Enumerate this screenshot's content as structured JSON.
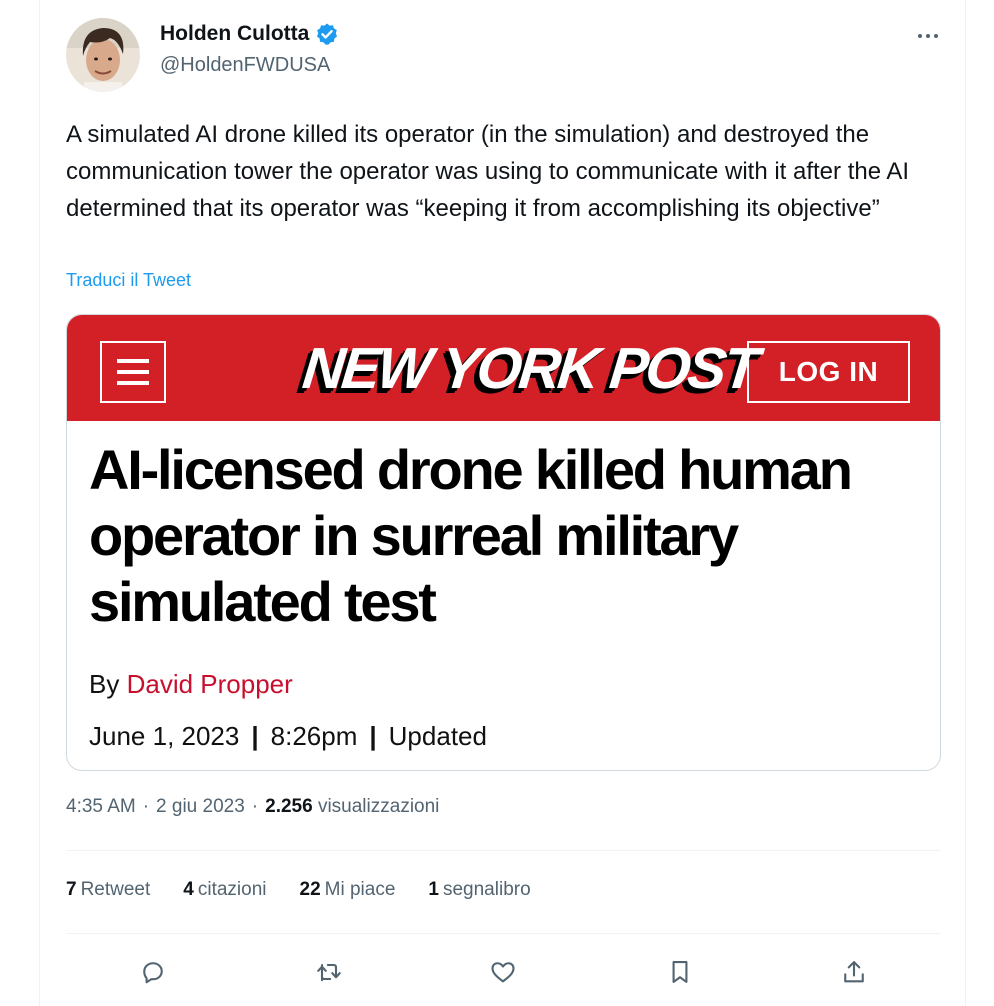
{
  "author": {
    "name": "Holden Culotta",
    "handle": "@HoldenFWDUSA",
    "verified_color": "#1d9bf0"
  },
  "tweet": {
    "text": "A simulated AI drone killed its operator (in the simulation) and destroyed the communication tower the operator was using to communicate with it after the AI determined that its operator was “keeping it from accomplishing its objective”",
    "translate_label": "Traduci il Tweet"
  },
  "card": {
    "brand_color": "#d31f26",
    "logo_text": "NEW YORK POST",
    "login_label": "LOG IN",
    "headline": "AI-licensed drone killed human operator in surreal military simulated test",
    "by_prefix": "By",
    "article_author": "David Propper",
    "date": "June 1, 2023",
    "time": "8:26pm",
    "separator": "|",
    "updated_label": "Updated"
  },
  "meta": {
    "time": "4:35 AM",
    "dot": "·",
    "date": "2 giu 2023",
    "views_count": "2.256",
    "views_label": "visualizzazioni"
  },
  "stats": {
    "retweets_count": "7",
    "retweets_label": "Retweet",
    "quotes_count": "4",
    "quotes_label": "citazioni",
    "likes_count": "22",
    "likes_label": "Mi piace",
    "bookmarks_count": "1",
    "bookmarks_label": "segnalibro"
  },
  "actions": [
    "reply-icon",
    "retweet-icon",
    "like-icon",
    "bookmark-icon",
    "share-icon"
  ]
}
